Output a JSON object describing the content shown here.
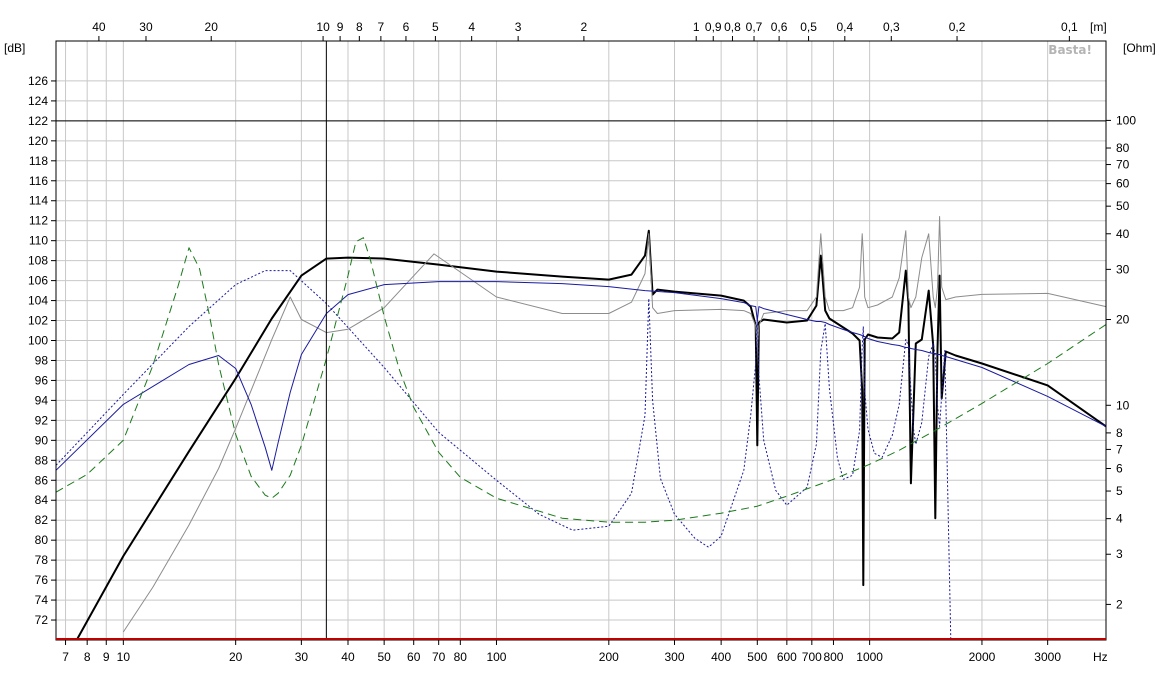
{
  "chart_data": {
    "type": "line",
    "title": "",
    "watermark": "Basta!",
    "x_scale": "log",
    "x_unit_label": "Hz",
    "xlim": [
      6.6,
      4300
    ],
    "x_ticks": [
      {
        "v": 7,
        "label": "7"
      },
      {
        "v": 8,
        "label": "8"
      },
      {
        "v": 9,
        "label": "9"
      },
      {
        "v": 10,
        "label": "10"
      },
      {
        "v": 20,
        "label": "20"
      },
      {
        "v": 30,
        "label": "30"
      },
      {
        "v": 40,
        "label": "40"
      },
      {
        "v": 50,
        "label": "50"
      },
      {
        "v": 60,
        "label": "60"
      },
      {
        "v": 70,
        "label": "70"
      },
      {
        "v": 80,
        "label": "80"
      },
      {
        "v": 100,
        "label": "100"
      },
      {
        "v": 200,
        "label": "200"
      },
      {
        "v": 300,
        "label": "300"
      },
      {
        "v": 400,
        "label": "400"
      },
      {
        "v": 500,
        "label": "500"
      },
      {
        "v": 600,
        "label": "600"
      },
      {
        "v": 700,
        "label": "700"
      },
      {
        "v": 800,
        "label": "800"
      },
      {
        "v": 1000,
        "label": "1000"
      },
      {
        "v": 2000,
        "label": "2000"
      },
      {
        "v": 3000,
        "label": "3000"
      }
    ],
    "top_axis_unit_label": "[m]",
    "top_axis_ticks": [
      {
        "hz": 8.6,
        "label": "40"
      },
      {
        "hz": 11.5,
        "label": "30"
      },
      {
        "hz": 17.2,
        "label": "20"
      },
      {
        "hz": 34.3,
        "label": "10"
      },
      {
        "hz": 38.1,
        "label": "9"
      },
      {
        "hz": 42.9,
        "label": "8"
      },
      {
        "hz": 49,
        "label": "7"
      },
      {
        "hz": 57.2,
        "label": "6"
      },
      {
        "hz": 68.6,
        "label": "5"
      },
      {
        "hz": 85.8,
        "label": "4"
      },
      {
        "hz": 114.3,
        "label": "3"
      },
      {
        "hz": 171.5,
        "label": "2"
      },
      {
        "hz": 343,
        "label": "1"
      },
      {
        "hz": 381,
        "label": "0,9"
      },
      {
        "hz": 429,
        "label": "0,8"
      },
      {
        "hz": 490,
        "label": "0,7"
      },
      {
        "hz": 572,
        "label": "0,6"
      },
      {
        "hz": 686,
        "label": "0,5"
      },
      {
        "hz": 858,
        "label": "0,4"
      },
      {
        "hz": 1143,
        "label": "0,3"
      },
      {
        "hz": 1715,
        "label": "0,2"
      },
      {
        "hz": 3430,
        "label": "0,1"
      }
    ],
    "y_left_label": "[dB]",
    "ylim_left": [
      70,
      130
    ],
    "y_left_ticks": [
      72,
      74,
      76,
      78,
      80,
      82,
      84,
      86,
      88,
      90,
      92,
      94,
      96,
      98,
      100,
      102,
      104,
      106,
      108,
      110,
      112,
      114,
      116,
      118,
      120,
      122,
      124,
      126
    ],
    "y_right_label": "[Ohm]",
    "ylim_right": [
      1.5,
      190
    ],
    "y_right_scale": "log",
    "y_right_ticks": [
      {
        "v": 2,
        "label": "2"
      },
      {
        "v": 3,
        "label": "3"
      },
      {
        "v": 4,
        "label": "4"
      },
      {
        "v": 5,
        "label": "5"
      },
      {
        "v": 6,
        "label": "6"
      },
      {
        "v": 7,
        "label": "7"
      },
      {
        "v": 8,
        "label": "8"
      },
      {
        "v": 10,
        "label": "10"
      },
      {
        "v": 20,
        "label": "20"
      },
      {
        "v": 30,
        "label": "30"
      },
      {
        "v": 40,
        "label": "40"
      },
      {
        "v": 50,
        "label": "50"
      },
      {
        "v": 60,
        "label": "60"
      },
      {
        "v": 70,
        "label": "70"
      },
      {
        "v": 80,
        "label": "80"
      },
      {
        "v": 100,
        "label": "100"
      }
    ],
    "grid": true,
    "cursor": {
      "x": 35,
      "y": 122
    },
    "colors": {
      "grid": "#c8c8c8",
      "frame": "#000000",
      "black_series": "#000000",
      "gray_series": "#8c8c8c",
      "blue_series": "#1a1aa0",
      "green_series": "#1a7a1a",
      "baseline": "#c00000"
    },
    "series": [
      {
        "axis": "left",
        "color": "#000000",
        "style": "solid-thick",
        "x": [
          7.5,
          10,
          15,
          20,
          25,
          30,
          35,
          40,
          50,
          70,
          100,
          150,
          200,
          230,
          250,
          256,
          262,
          270,
          300,
          400,
          460,
          480,
          495,
          500,
          505,
          520,
          600,
          680,
          720,
          740,
          760,
          780,
          850,
          900,
          940,
          955,
          962,
          970,
          990,
          1050,
          1150,
          1200,
          1250,
          1270,
          1290,
          1330,
          1380,
          1440,
          1480,
          1500,
          1520,
          1540,
          1560,
          1600,
          1700,
          2000,
          3000,
          4300
        ],
        "y": [
          70,
          78.4,
          88.9,
          96.2,
          102.2,
          106.5,
          108.2,
          108.3,
          108.2,
          107.6,
          106.9,
          106.4,
          106.1,
          106.6,
          108.5,
          111,
          104.6,
          105.1,
          104.9,
          104.5,
          104,
          103.4,
          101.5,
          89.5,
          101.8,
          102.1,
          101.8,
          102,
          103.5,
          108.5,
          103,
          102.2,
          101.3,
          100.7,
          100,
          95,
          75.5,
          100.1,
          100.6,
          100.3,
          100.2,
          100.8,
          107,
          103.8,
          85.7,
          99.7,
          100.1,
          105,
          99.5,
          82.2,
          99.2,
          106.5,
          94.2,
          98.9,
          98.5,
          97.7,
          95.5,
          91.4
        ]
      },
      {
        "axis": "right",
        "color": "#8c8c8c",
        "style": "solid-thin",
        "x": [
          10,
          12,
          15,
          18,
          20,
          25,
          28,
          30,
          35,
          40,
          50,
          68,
          100,
          150,
          200,
          230,
          250,
          256,
          262,
          270,
          300,
          400,
          460,
          480,
          495,
          500,
          505,
          520,
          600,
          680,
          720,
          740,
          760,
          780,
          850,
          900,
          940,
          955,
          962,
          970,
          990,
          1050,
          1150,
          1200,
          1250,
          1270,
          1290,
          1330,
          1380,
          1440,
          1480,
          1500,
          1520,
          1540,
          1560,
          1600,
          1700,
          2000,
          3000,
          4300
        ],
        "y": [
          1.6,
          2.3,
          3.8,
          6,
          8.3,
          17,
          24,
          20,
          18,
          18.5,
          22,
          34,
          24,
          21,
          21,
          23,
          29,
          40,
          22,
          21,
          21.5,
          21.7,
          21.5,
          21,
          19,
          16,
          19,
          21,
          21.5,
          21.5,
          24,
          40,
          24,
          21.5,
          21.5,
          22,
          26,
          40,
          34,
          24,
          22,
          22.5,
          24,
          28,
          41,
          24,
          22,
          24,
          33,
          40,
          24,
          22,
          26,
          46,
          26,
          23.5,
          24,
          24.5,
          24.7,
          22.2
        ]
      },
      {
        "axis": "left",
        "color": "#1a1aa0",
        "style": "solid-thin",
        "x": [
          6.6,
          10,
          15,
          18,
          20,
          22,
          24,
          25,
          26,
          28,
          30,
          35,
          40,
          50,
          70,
          100,
          150,
          200,
          250,
          300,
          400,
          460,
          480,
          495,
          500,
          505,
          520,
          600,
          680,
          720,
          740,
          760,
          780,
          850,
          900,
          940,
          955,
          962,
          970,
          990,
          1050,
          1150,
          1200,
          1250,
          1270,
          1290,
          1330,
          1380,
          1440,
          1480,
          1500,
          1520,
          1540,
          1560,
          1600,
          1700,
          2000,
          3000,
          4300
        ],
        "y": [
          87,
          93.6,
          97.6,
          98.5,
          97.2,
          93.6,
          89.3,
          87,
          89.8,
          94.8,
          98.6,
          102.7,
          104.6,
          105.6,
          105.9,
          105.9,
          105.7,
          105.4,
          105,
          104.8,
          104.2,
          103.8,
          103.5,
          103.4,
          102,
          103.4,
          103.2,
          102.6,
          102.1,
          101.9,
          101.9,
          101.8,
          101.6,
          101.1,
          100.8,
          100.6,
          100.5,
          100.4,
          100.4,
          100.2,
          99.9,
          99.6,
          99.5,
          99.3,
          99.3,
          99.2,
          99.1,
          99,
          98.8,
          98.7,
          98.7,
          98.6,
          98.6,
          98.5,
          98.4,
          98.1,
          97.3,
          94.4,
          91.4
        ]
      },
      {
        "axis": "left",
        "color": "#1a1aa0",
        "style": "dotted",
        "x": [
          6.6,
          10,
          15,
          20,
          24,
          28,
          35,
          50,
          70,
          100,
          130,
          160,
          200,
          230,
          250,
          256,
          262,
          275,
          300,
          340,
          370,
          400,
          460,
          480,
          495,
          500,
          505,
          520,
          560,
          600,
          680,
          720,
          740,
          760,
          780,
          820,
          850,
          900,
          940,
          955,
          962,
          970,
          990,
          1030,
          1080,
          1150,
          1200,
          1250,
          1270,
          1290,
          1310,
          1330,
          1380,
          1440,
          1480,
          1500,
          1520,
          1540,
          1560,
          1590,
          1650,
          1700,
          2000,
          3000,
          4300
        ],
        "y": [
          87.5,
          94.6,
          101.4,
          105.6,
          107,
          107,
          103.7,
          97.3,
          90.8,
          86,
          82.6,
          81,
          81.4,
          84.7,
          92.5,
          104.2,
          94,
          86.2,
          82.6,
          80.2,
          79.3,
          80.4,
          87,
          92.5,
          97.7,
          102.5,
          96.5,
          90,
          85,
          83.5,
          85.3,
          89.6,
          99,
          101.7,
          95.2,
          88.2,
          86.1,
          86.5,
          91,
          99.3,
          101.4,
          95,
          91.1,
          88.7,
          88.3,
          90.5,
          93.6,
          100.1,
          99.5,
          95,
          91.2,
          89.6,
          91.8,
          98.4,
          99.7,
          98.4,
          93.5,
          91.4,
          94.5,
          99,
          70,
          70,
          70,
          70,
          70
        ]
      },
      {
        "axis": "left",
        "color": "#1a7a1a",
        "style": "dashed",
        "x": [
          6.6,
          8,
          10,
          12,
          14,
          15,
          16,
          17,
          18,
          20,
          22,
          24,
          25,
          26,
          28,
          30,
          35,
          40,
          42,
          44,
          46,
          50,
          55,
          60,
          70,
          80,
          100,
          150,
          200,
          250,
          300,
          400,
          500,
          600,
          800,
          1000,
          1200,
          1500,
          2000,
          3000,
          4300
        ],
        "y": [
          84.8,
          86.6,
          90,
          97.5,
          105.4,
          109.3,
          107.2,
          102.6,
          97.6,
          90.6,
          86.4,
          84.5,
          84.2,
          84.7,
          86.5,
          89.5,
          98.2,
          106.5,
          109.9,
          110.3,
          108,
          102.4,
          97,
          93.3,
          88.8,
          86.3,
          84.2,
          82.2,
          81.8,
          81.8,
          82,
          82.7,
          83.4,
          84.4,
          86.1,
          87.6,
          89,
          91,
          93.7,
          97.7,
          101.6
        ]
      }
    ]
  }
}
